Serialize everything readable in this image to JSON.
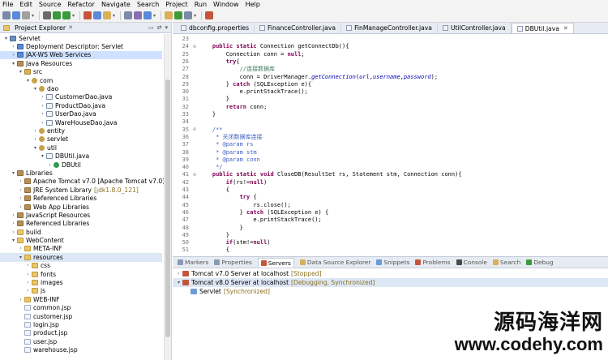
{
  "menu": [
    "File",
    "Edit",
    "Source",
    "Refactor",
    "Navigate",
    "Search",
    "Project",
    "Run",
    "Window",
    "Help"
  ],
  "toolbar": {
    "colors": [
      "#7a8aa8",
      "#5a8ad8",
      "#a0a0a0",
      "#6a6a6a",
      "#3c9a3c",
      "#3c9a3c",
      "#c5553a",
      "#5a8ad8",
      "#d7b05a",
      "#7a8aa8",
      "#8a6fb0",
      "#5a8ad8",
      "#d7b05a",
      "#3c9a3c",
      "#7a8aa8",
      "#c5553a"
    ]
  },
  "explorer": {
    "tab_label": "Project Explorer",
    "tab_close": "✕",
    "rows": [
      {
        "indent": 0,
        "twisty": "▾",
        "icon": "project",
        "label": "Servlet",
        "suffix": "",
        "style": ""
      },
      {
        "indent": 1,
        "twisty": "›",
        "icon": "ws",
        "label": "Deployment Descriptor: Servlet",
        "suffix": "",
        "style": ""
      },
      {
        "indent": 1,
        "twisty": "›",
        "icon": "ws",
        "label": "JAX-WS Web Services",
        "suffix": "",
        "style": "hl"
      },
      {
        "indent": 1,
        "twisty": "▾",
        "icon": "lib",
        "label": "Java Resources",
        "suffix": "",
        "style": ""
      },
      {
        "indent": 2,
        "twisty": "▾",
        "icon": "src",
        "label": "src",
        "suffix": "",
        "style": ""
      },
      {
        "indent": 3,
        "twisty": "▾",
        "icon": "pkg",
        "label": "com",
        "suffix": "",
        "style": ""
      },
      {
        "indent": 4,
        "twisty": "▾",
        "icon": "pkg",
        "label": "dao",
        "suffix": "",
        "style": ""
      },
      {
        "indent": 5,
        "twisty": "›",
        "icon": "java",
        "label": "CustomerDao.java",
        "suffix": "",
        "style": ""
      },
      {
        "indent": 5,
        "twisty": "›",
        "icon": "java",
        "label": "ProductDao.java",
        "suffix": "",
        "style": ""
      },
      {
        "indent": 5,
        "twisty": "›",
        "icon": "java",
        "label": "UserDao.java",
        "suffix": "",
        "style": ""
      },
      {
        "indent": 5,
        "twisty": "›",
        "icon": "java",
        "label": "WareHouseDao.java",
        "suffix": "",
        "style": ""
      },
      {
        "indent": 4,
        "twisty": "›",
        "icon": "pkg",
        "label": "entity",
        "suffix": "",
        "style": ""
      },
      {
        "indent": 4,
        "twisty": "›",
        "icon": "pkg",
        "label": "servlet",
        "suffix": "",
        "style": ""
      },
      {
        "indent": 4,
        "twisty": "▾",
        "icon": "pkg",
        "label": "util",
        "suffix": "",
        "style": ""
      },
      {
        "indent": 5,
        "twisty": "▾",
        "icon": "java",
        "label": "DBUtil.java",
        "suffix": "",
        "style": ""
      },
      {
        "indent": 6,
        "twisty": "›",
        "icon": "cls",
        "label": "DBUtil",
        "suffix": "",
        "style": ""
      },
      {
        "indent": 1,
        "twisty": "▾",
        "icon": "lib",
        "label": "Libraries",
        "suffix": "",
        "style": ""
      },
      {
        "indent": 2,
        "twisty": "›",
        "icon": "lib",
        "label": "Apache Tomcat v7.0 [Apache Tomcat v7.0]",
        "suffix": "",
        "style": ""
      },
      {
        "indent": 2,
        "twisty": "›",
        "icon": "lib",
        "label": "JRE System Library",
        "suffix": "[jdk1.8.0_121]",
        "style": ""
      },
      {
        "indent": 2,
        "twisty": "›",
        "icon": "lib",
        "label": "Referenced Libraries",
        "suffix": "",
        "style": ""
      },
      {
        "indent": 2,
        "twisty": "›",
        "icon": "lib",
        "label": "Web App Libraries",
        "suffix": "",
        "style": ""
      },
      {
        "indent": 1,
        "twisty": "›",
        "icon": "lib",
        "label": "JavaScript Resources",
        "suffix": "",
        "style": ""
      },
      {
        "indent": 1,
        "twisty": "›",
        "icon": "lib",
        "label": "Referenced Libraries",
        "suffix": "",
        "style": ""
      },
      {
        "indent": 1,
        "twisty": "›",
        "icon": "folder",
        "label": "build",
        "suffix": "",
        "style": ""
      },
      {
        "indent": 1,
        "twisty": "▾",
        "icon": "folder",
        "label": "WebContent",
        "suffix": "",
        "style": ""
      },
      {
        "indent": 2,
        "twisty": "›",
        "icon": "folder",
        "label": "META-INF",
        "suffix": "",
        "style": ""
      },
      {
        "indent": 2,
        "twisty": "▾",
        "icon": "folder",
        "label": "resources",
        "suffix": "",
        "style": "sel"
      },
      {
        "indent": 3,
        "twisty": "›",
        "icon": "folder",
        "label": "css",
        "suffix": "",
        "style": ""
      },
      {
        "indent": 3,
        "twisty": "›",
        "icon": "folder",
        "label": "fonts",
        "suffix": "",
        "style": ""
      },
      {
        "indent": 3,
        "twisty": "›",
        "icon": "folder",
        "label": "images",
        "suffix": "",
        "style": ""
      },
      {
        "indent": 3,
        "twisty": "›",
        "icon": "folder",
        "label": "js",
        "suffix": "",
        "style": ""
      },
      {
        "indent": 2,
        "twisty": "›",
        "icon": "folder",
        "label": "WEB-INF",
        "suffix": "",
        "style": ""
      },
      {
        "indent": 2,
        "twisty": "",
        "icon": "jsp",
        "label": "common.jsp",
        "suffix": "",
        "style": ""
      },
      {
        "indent": 2,
        "twisty": "",
        "icon": "jsp",
        "label": "customer.jsp",
        "suffix": "",
        "style": ""
      },
      {
        "indent": 2,
        "twisty": "",
        "icon": "jsp",
        "label": "login.jsp",
        "suffix": "",
        "style": ""
      },
      {
        "indent": 2,
        "twisty": "",
        "icon": "jsp",
        "label": "product.jsp",
        "suffix": "",
        "style": ""
      },
      {
        "indent": 2,
        "twisty": "",
        "icon": "jsp",
        "label": "user.jsp",
        "suffix": "",
        "style": ""
      },
      {
        "indent": 2,
        "twisty": "",
        "icon": "jsp",
        "label": "warehouse.jsp",
        "suffix": "",
        "style": ""
      }
    ]
  },
  "editor": {
    "tabs": [
      {
        "label": "dbconfig.properties",
        "active": false
      },
      {
        "label": "FinanceController.java",
        "active": false
      },
      {
        "label": "FinManageController.java",
        "active": false
      },
      {
        "label": "UtilController.java",
        "active": false
      },
      {
        "label": "DBUtil.java",
        "active": true
      }
    ],
    "lines": [
      {
        "n": "23",
        "fold": "",
        "segs": []
      },
      {
        "n": "24",
        "fold": "⊖",
        "segs": [
          [
            "",
            "    "
          ],
          [
            "kw",
            "public static "
          ],
          [
            "",
            "Connection getConnectDb(){"
          ]
        ]
      },
      {
        "n": "25",
        "fold": "",
        "segs": [
          [
            "",
            "        Connection conn = "
          ],
          [
            "kw",
            "null"
          ],
          [
            "",
            ";"
          ]
        ]
      },
      {
        "n": "26",
        "fold": "",
        "segs": [
          [
            "",
            "        "
          ],
          [
            "kw",
            "try"
          ],
          [
            "",
            "{"
          ]
        ]
      },
      {
        "n": "27",
        "fold": "",
        "segs": [
          [
            "",
            "            "
          ],
          [
            "cm",
            "//连接数据库"
          ]
        ]
      },
      {
        "n": "28",
        "fold": "",
        "segs": [
          [
            "",
            "            conn = DriverManager."
          ],
          [
            "it",
            "getConnection"
          ],
          [
            "",
            "("
          ],
          [
            "it",
            "url"
          ],
          [
            "",
            ","
          ],
          [
            "it",
            "username"
          ],
          [
            "",
            ","
          ],
          [
            "it",
            "password"
          ],
          [
            "",
            ");"
          ]
        ]
      },
      {
        "n": "29",
        "fold": "",
        "segs": [
          [
            "",
            "        } "
          ],
          [
            "kw",
            "catch"
          ],
          [
            "",
            " (SQLException e){"
          ]
        ]
      },
      {
        "n": "30",
        "fold": "",
        "segs": [
          [
            "",
            "            e.printStackTrace();"
          ]
        ]
      },
      {
        "n": "31",
        "fold": "",
        "segs": [
          [
            "",
            "        }"
          ]
        ]
      },
      {
        "n": "32",
        "fold": "",
        "segs": [
          [
            "",
            "        "
          ],
          [
            "kw",
            "return"
          ],
          [
            "",
            " conn;"
          ]
        ]
      },
      {
        "n": "33",
        "fold": "",
        "segs": [
          [
            "",
            "    }"
          ]
        ]
      },
      {
        "n": "34",
        "fold": "",
        "segs": []
      },
      {
        "n": "35",
        "fold": "⊖",
        "segs": [
          [
            "",
            "    "
          ],
          [
            "jd",
            "/**"
          ]
        ]
      },
      {
        "n": "36",
        "fold": "",
        "segs": [
          [
            "jd",
            "     * 关闭数据库连接"
          ]
        ]
      },
      {
        "n": "37",
        "fold": "",
        "segs": [
          [
            "jd",
            "     * @param rs"
          ]
        ]
      },
      {
        "n": "38",
        "fold": "",
        "segs": [
          [
            "jd",
            "     * @param stm"
          ]
        ]
      },
      {
        "n": "39",
        "fold": "",
        "segs": [
          [
            "jd",
            "     * @param conn"
          ]
        ]
      },
      {
        "n": "40",
        "fold": "",
        "segs": [
          [
            "jd",
            "     */"
          ]
        ]
      },
      {
        "n": "41",
        "fold": "⊖",
        "segs": [
          [
            "",
            "    "
          ],
          [
            "kw",
            "public static void "
          ],
          [
            "",
            "CloseDB(ResultSet rs, Statement stm, Connection conn){"
          ]
        ]
      },
      {
        "n": "42",
        "fold": "",
        "segs": [
          [
            "",
            "        "
          ],
          [
            "kw",
            "if"
          ],
          [
            "",
            "(rs!="
          ],
          [
            "kw",
            "null"
          ],
          [
            "",
            ")"
          ]
        ]
      },
      {
        "n": "43",
        "fold": "",
        "segs": [
          [
            "",
            "        {"
          ]
        ]
      },
      {
        "n": "44",
        "fold": "",
        "segs": [
          [
            "",
            "            "
          ],
          [
            "kw",
            "try"
          ],
          [
            "",
            " {"
          ]
        ]
      },
      {
        "n": "45",
        "fold": "",
        "segs": [
          [
            "",
            "                rs.close();"
          ]
        ]
      },
      {
        "n": "46",
        "fold": "",
        "segs": [
          [
            "",
            "            } "
          ],
          [
            "kw",
            "catch"
          ],
          [
            "",
            " (SQLException e) {"
          ]
        ]
      },
      {
        "n": "47",
        "fold": "",
        "segs": [
          [
            "",
            "                e.printStackTrace();"
          ]
        ]
      },
      {
        "n": "48",
        "fold": "",
        "segs": [
          [
            "",
            "            }"
          ]
        ]
      },
      {
        "n": "49",
        "fold": "",
        "segs": [
          [
            "",
            "        }"
          ]
        ]
      },
      {
        "n": "50",
        "fold": "",
        "segs": [
          [
            "",
            "        "
          ],
          [
            "kw",
            "if"
          ],
          [
            "",
            "(stm!="
          ],
          [
            "kw",
            "null"
          ],
          [
            "",
            ")"
          ]
        ]
      },
      {
        "n": "51",
        "fold": "",
        "segs": [
          [
            "",
            "        {"
          ]
        ]
      }
    ]
  },
  "bottom": {
    "tabs": [
      {
        "label": "Markers",
        "active": false,
        "color": "#8a9ab4"
      },
      {
        "label": "Properties",
        "active": false,
        "color": "#8a9ab4"
      },
      {
        "label": "Servers",
        "active": true,
        "color": "#c5553a"
      },
      {
        "label": "Data Source Explorer",
        "active": false,
        "color": "#d7b05a"
      },
      {
        "label": "Snippets",
        "active": false,
        "color": "#6a9ad8"
      },
      {
        "label": "Problems",
        "active": false,
        "color": "#c5553a"
      },
      {
        "label": "Console",
        "active": false,
        "color": "#4a4a4a"
      },
      {
        "label": "Search",
        "active": false,
        "color": "#d7b05a"
      },
      {
        "label": "Debug",
        "active": false,
        "color": "#3c9a3c"
      }
    ],
    "servers": [
      {
        "indent": 0,
        "twisty": "›",
        "icon": "server",
        "label": "Tomcat v7.0 Server at localhost",
        "status": "[Stopped]",
        "sel": false
      },
      {
        "indent": 0,
        "twisty": "▾",
        "icon": "server",
        "label": "Tomcat v8.0 Server at localhost",
        "status": "[Debugging, Synchronized]",
        "sel": true
      },
      {
        "indent": 1,
        "twisty": "",
        "icon": "mod",
        "label": "Servlet",
        "status": "[Synchronized]",
        "sel": false
      }
    ]
  },
  "watermark": {
    "cn": "源码海洋网",
    "url": "www.codehy.com"
  }
}
